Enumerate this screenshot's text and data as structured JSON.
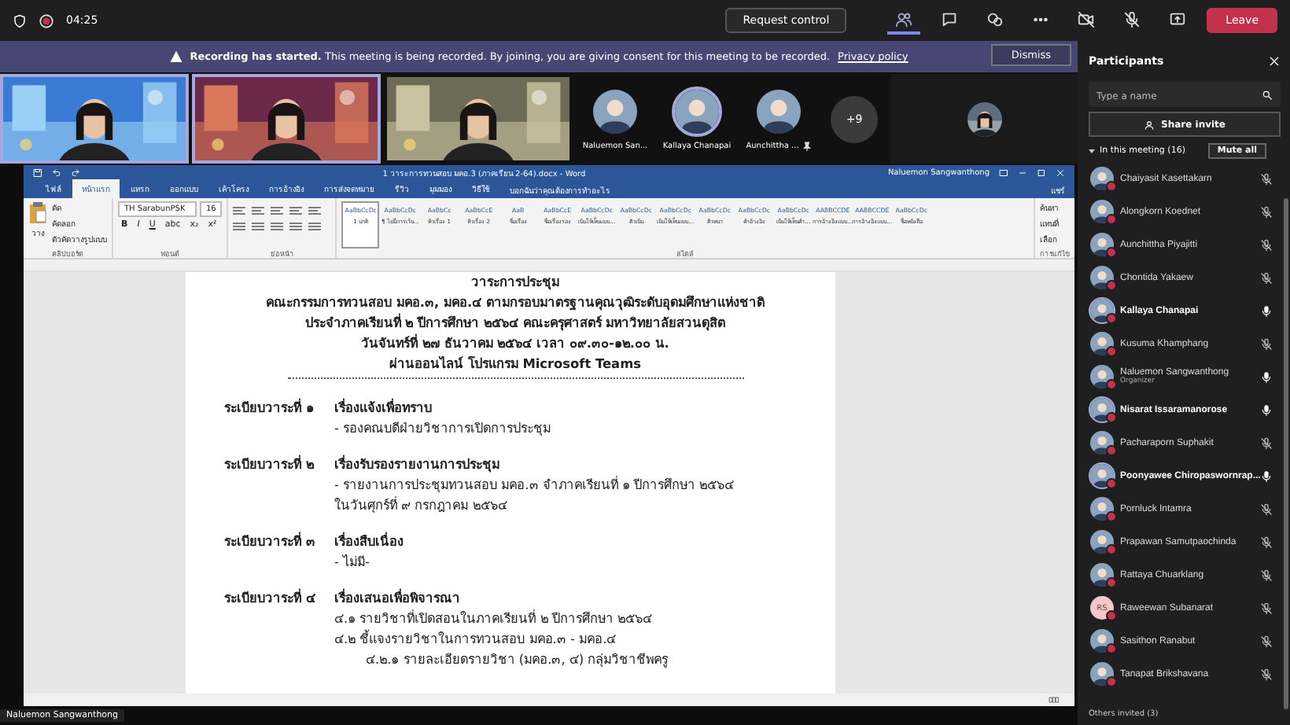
{
  "top_bar": {
    "timer": "04:25",
    "request_control": "Request control",
    "leave": "Leave",
    "toolbar": [
      {
        "kind": "people",
        "selected": true
      },
      {
        "kind": "chat",
        "selected": false
      },
      {
        "kind": "reactions",
        "selected": false
      },
      {
        "kind": "more",
        "selected": false
      },
      {
        "kind": "camera-off",
        "selected": false
      },
      {
        "kind": "mic-off",
        "selected": false
      },
      {
        "kind": "share",
        "selected": false
      }
    ]
  },
  "banner": {
    "message": "**Recording has started.** This meeting is being recorded. By joining, you are giving consent for this meeting to be recorded.",
    "link": "Privacy policy",
    "dismiss": "Dismiss"
  },
  "video_strip": [
    {
      "kind": "video",
      "selected": true
    },
    {
      "kind": "video",
      "selected": true
    },
    {
      "kind": "video",
      "selected": false
    },
    {
      "kind": "avatar",
      "name": "Naluemon San...",
      "speaking": false,
      "pinned": false
    },
    {
      "kind": "avatar",
      "name": "Kallaya Chanapai",
      "speaking": true,
      "pinned": false
    },
    {
      "kind": "avatar",
      "name": "Aunchittha ...",
      "speaking": false,
      "pinned": true
    },
    {
      "kind": "overflow",
      "label": "+9"
    },
    {
      "kind": "small-video"
    }
  ],
  "word": {
    "title": "1 วาระการทวนสอบ มคอ.3 (ภาคเรียน 2-64).docx - Word",
    "user": "Naluemon Sangwanthong",
    "tabs": [
      {
        "label": "ไฟล์",
        "selected": false
      },
      {
        "label": "หน้าแรก",
        "selected": true
      },
      {
        "label": "แทรก",
        "selected": false
      },
      {
        "label": "ออกแบบ",
        "selected": false
      },
      {
        "label": "เค้าโครง",
        "selected": false
      },
      {
        "label": "การอ้างอิง",
        "selected": false
      },
      {
        "label": "การส่งจดหมาย",
        "selected": false
      },
      {
        "label": "รีวิว",
        "selected": false
      },
      {
        "label": "มุมมอง",
        "selected": false
      },
      {
        "label": "วิธีใช้",
        "selected": false
      }
    ],
    "tell_me": "บอกฉันว่าคุณต้องการทำอะไร",
    "share": "แชร์",
    "clipboard": {
      "paste": "วาง",
      "items": [
        "ตัด",
        "คัดลอก",
        "ตัวคัดวางรูปแบบ"
      ]
    },
    "font": {
      "family": "TH SarabunPSK",
      "size": "16",
      "buttons": [
        "B",
        "I",
        "U",
        "abc",
        "x₂",
        "x²"
      ]
    },
    "styles": [
      {
        "sample": "AaBbCcDc",
        "name": "1 ปกติ",
        "selected": true
      },
      {
        "sample": "AaBbCcDc",
        "name": "¶ ไม่มีการเว้น...",
        "selected": false
      },
      {
        "sample": "AaBbCc",
        "name": "หัวเรื่อง 1",
        "selected": false
      },
      {
        "sample": "AaBbCcE",
        "name": "หัวเรื่อง 2",
        "selected": false
      },
      {
        "sample": "AaB",
        "name": "ชื่อเรื่อง",
        "selected": false
      },
      {
        "sample": "AaBbCcE",
        "name": "ชื่อเรื่องรอง",
        "selected": false
      },
      {
        "sample": "AaBbCcDc",
        "name": "เน้นให้เห็นแบบ...",
        "selected": false
      },
      {
        "sample": "AaBbCcDc",
        "name": "ตัวเน้น",
        "selected": false
      },
      {
        "sample": "AaBbCcDc",
        "name": "เน้นให้เห็นแบบ...",
        "selected": false
      },
      {
        "sample": "AaBbCcDc",
        "name": "ตัวหนา",
        "selected": false
      },
      {
        "sample": "AaBbCcDc",
        "name": "คำอ้างอิง",
        "selected": false
      },
      {
        "sample": "AaBbCcDc",
        "name": "เน้นให้เห็นคำ...",
        "selected": false
      },
      {
        "sample": "AABBCCDE",
        "name": "การอ้างอิงแบบ...",
        "selected": false
      },
      {
        "sample": "AABBCCDE",
        "name": "การอ้างอิงแบบ...",
        "selected": false
      },
      {
        "sample": "AaBbCcDc",
        "name": "ชื่อหนังสือ",
        "selected": false
      }
    ],
    "editing": [
      "ค้นหา",
      "แทนที่",
      "เลือก"
    ],
    "groups": [
      "คลิปบอร์ด",
      "ฟอนต์",
      "ย่อหน้า",
      "สไตล์",
      "การแก้ไข"
    ],
    "document": {
      "heading": [
        "วาระการประชุม",
        "คณะกรรมการทวนสอบ มคอ.๓, มคอ.๔ ตามกรอบมาตรฐานคุณวุฒิระดับอุดมศึกษาแห่งชาติ",
        "ประจำภาคเรียนที่ ๒ ปีการศึกษา ๒๕๖๔  คณะครุศาสตร์ มหาวิทยาลัยสวนดุสิต",
        "วันจันทร์ที่ ๒๗ ธันวาคม ๒๕๖๔ เวลา ๐๙.๓๐-๑๒.๐๐ น.",
        "ผ่านออนไลน์ โปรแกรม Microsoft Teams"
      ],
      "agenda": [
        {
          "label": "ระเบียบวาระที่ ๑",
          "title": "เรื่องแจ้งเพื่อทราบ",
          "lines": [
            {
              "text": "- รองคณบดีฝ่ายวิชาการเปิดการประชุม"
            }
          ]
        },
        {
          "label": "ระเบียบวาระที่ ๒",
          "title": "เรื่องรับรองรายงานการประชุม",
          "lines": [
            {
              "text": "- รายงานการประชุมทวนสอบ มคอ.๓ จำภาคเรียนที่ ๑ ปีการศึกษา ๒๕๖๔"
            },
            {
              "text": "ในวันศุกร์ที่ ๙ กรกฎาคม ๒๕๖๔"
            }
          ]
        },
        {
          "label": "ระเบียบวาระที่ ๓",
          "title": "เรื่องสืบเนื่อง",
          "lines": [
            {
              "text": "- ไม่มี-"
            }
          ]
        },
        {
          "label": "ระเบียบวาระที่ ๔",
          "title": "เรื่องเสนอเพื่อพิจารณา",
          "lines": [
            {
              "text": "๔.๑ รายวิชาที่เปิดสอนในภาคเรียนที่ ๒ ปีการศึกษา ๒๕๖๔"
            },
            {
              "text": "๔.๒ ชี้แจงรายวิชาในการทวนสอบ มคอ.๓ - มคอ.๔",
              "children": [
                {
                  "text": "๔.๒.๑ รายละเอียดรายวิชา (มคอ.๓, ๔) กลุ่มวิชาชีพครู"
                }
              ]
            }
          ]
        }
      ]
    }
  },
  "presenter_tag": "Naluemon Sangwanthong",
  "participants": {
    "title": "Participants",
    "search": {
      "placeholder": "Type a name"
    },
    "share_invite": "Share invite",
    "section": "In this meeting (16)",
    "mute_all": "Mute all",
    "people": [
      {
        "name": "Chaiyasit Kasettakarn",
        "muted": true,
        "speaking": false
      },
      {
        "name": "Alongkorn Koednet",
        "muted": true,
        "speaking": false
      },
      {
        "name": "Aunchittha Piyajitti",
        "muted": true,
        "speaking": false
      },
      {
        "name": "Chontida Yakaew",
        "muted": true,
        "speaking": false
      },
      {
        "name": "Kallaya Chanapai",
        "muted": false,
        "speaking": true
      },
      {
        "name": "Kusuma Khamphang",
        "muted": true,
        "speaking": false
      },
      {
        "name": "Naluemon Sangwanthong",
        "role": "Organizer",
        "muted": false,
        "speaking": false
      },
      {
        "name": "Nisarat Issaramanorose",
        "muted": false,
        "speaking": true
      },
      {
        "name": "Pacharaporn Suphakit",
        "muted": true,
        "speaking": false
      },
      {
        "name": "Poonyawee Chiropaswornrap...",
        "muted": false,
        "speaking": true
      },
      {
        "name": "Pornluck Intamra",
        "muted": true,
        "speaking": false
      },
      {
        "name": "Prapawan Samutpaochinda",
        "muted": true,
        "speaking": false
      },
      {
        "name": "Rattaya Chuarklang",
        "muted": true,
        "speaking": false
      },
      {
        "name": "Raweewan Subanarat",
        "kind": "initials",
        "initials": "RS",
        "muted": true,
        "speaking": false
      },
      {
        "name": "Sasithon Ranabut",
        "muted": true,
        "speaking": false
      },
      {
        "name": "Tanapat Brikshavana",
        "muted": true,
        "speaking": false
      }
    ],
    "others": "Others invited (3)"
  }
}
